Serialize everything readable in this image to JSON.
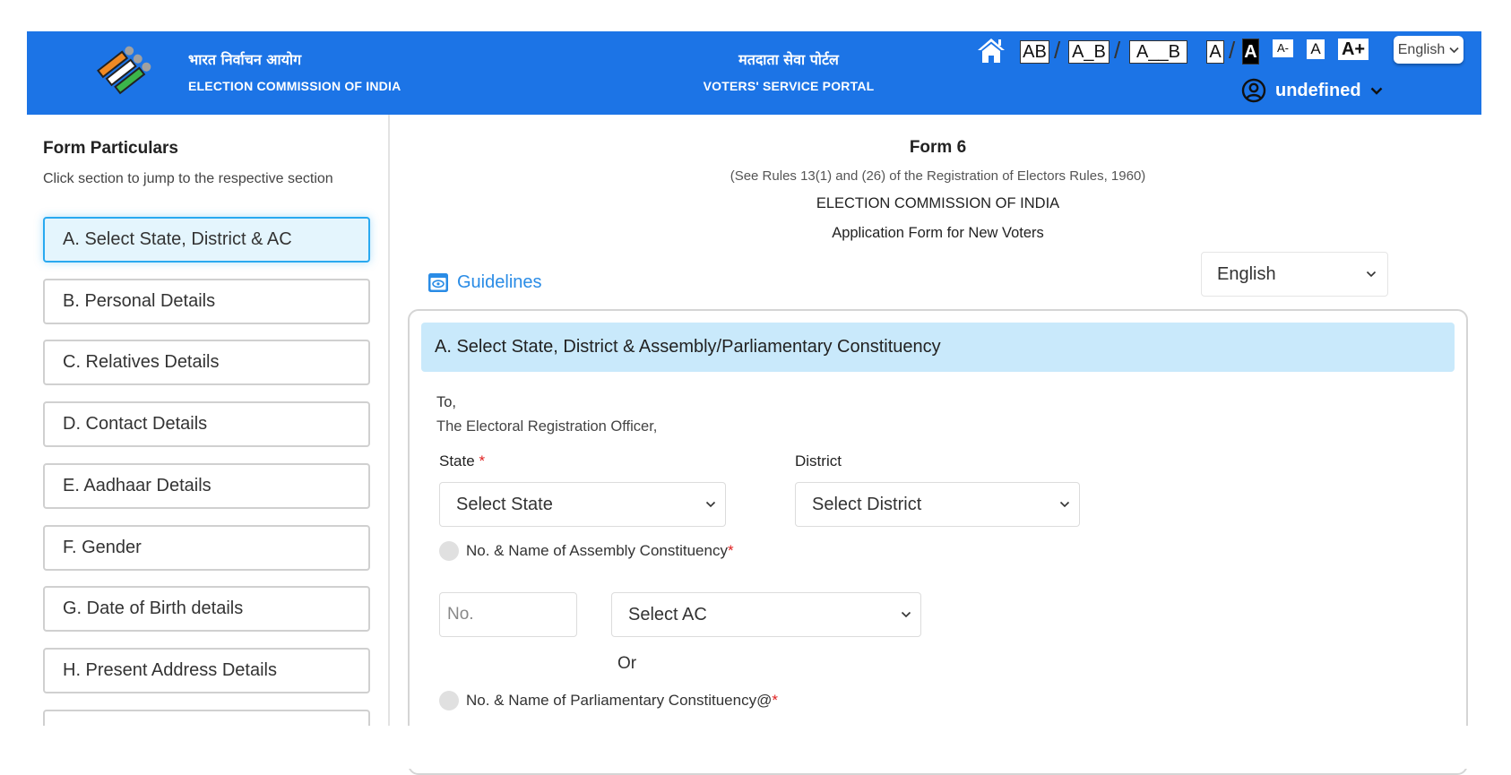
{
  "header": {
    "org_hindi": "भारत निर्वाचन आयोग",
    "org_english": "ELECTION COMMISSION OF INDIA",
    "portal_hindi": "मतदाता सेवा पोर्टल",
    "portal_english": "VOTERS' SERVICE PORTAL",
    "spacing_options": [
      "AB",
      "A_B",
      "A__B"
    ],
    "contrast_options": [
      "A",
      "A"
    ],
    "font_size_options": [
      "A-",
      "A",
      "A+"
    ],
    "language_button": "English",
    "user_name": "undefined",
    "brand_color": "#1c74e6"
  },
  "sidebar": {
    "title": "Form Particulars",
    "subtitle": "Click section to jump to the respective section",
    "active_index": 0,
    "items": [
      {
        "label": "A. Select State, District & AC"
      },
      {
        "label": "B. Personal Details"
      },
      {
        "label": "C. Relatives Details"
      },
      {
        "label": "D. Contact Details"
      },
      {
        "label": "E. Aadhaar Details"
      },
      {
        "label": "F. Gender"
      },
      {
        "label": "G. Date of Birth details"
      },
      {
        "label": "H. Present Address Details"
      },
      {
        "label": ""
      }
    ]
  },
  "form": {
    "title": "Form 6",
    "rules": "(See Rules 13(1) and (26) of the Registration of Electors Rules, 1960)",
    "authority": "ELECTION COMMISSION OF INDIA",
    "subtitle": "Application Form for New Voters",
    "guidelines_label": "Guidelines",
    "language_select": "English",
    "section_a": {
      "heading": "A. Select State, District & Assembly/Parliamentary Constituency",
      "to": "To,",
      "officer": "The Electoral Registration Officer,",
      "state_label": "State",
      "state_placeholder": "Select State",
      "district_label": "District",
      "district_placeholder": "Select District",
      "ac_radio_label": "No. & Name of Assembly Constituency",
      "ac_no_placeholder": "No.",
      "ac_select_placeholder": "Select AC",
      "or_label": "Or",
      "pc_radio_label": "No. & Name of Parliamentary Constituency@",
      "required_mark": "*"
    }
  }
}
